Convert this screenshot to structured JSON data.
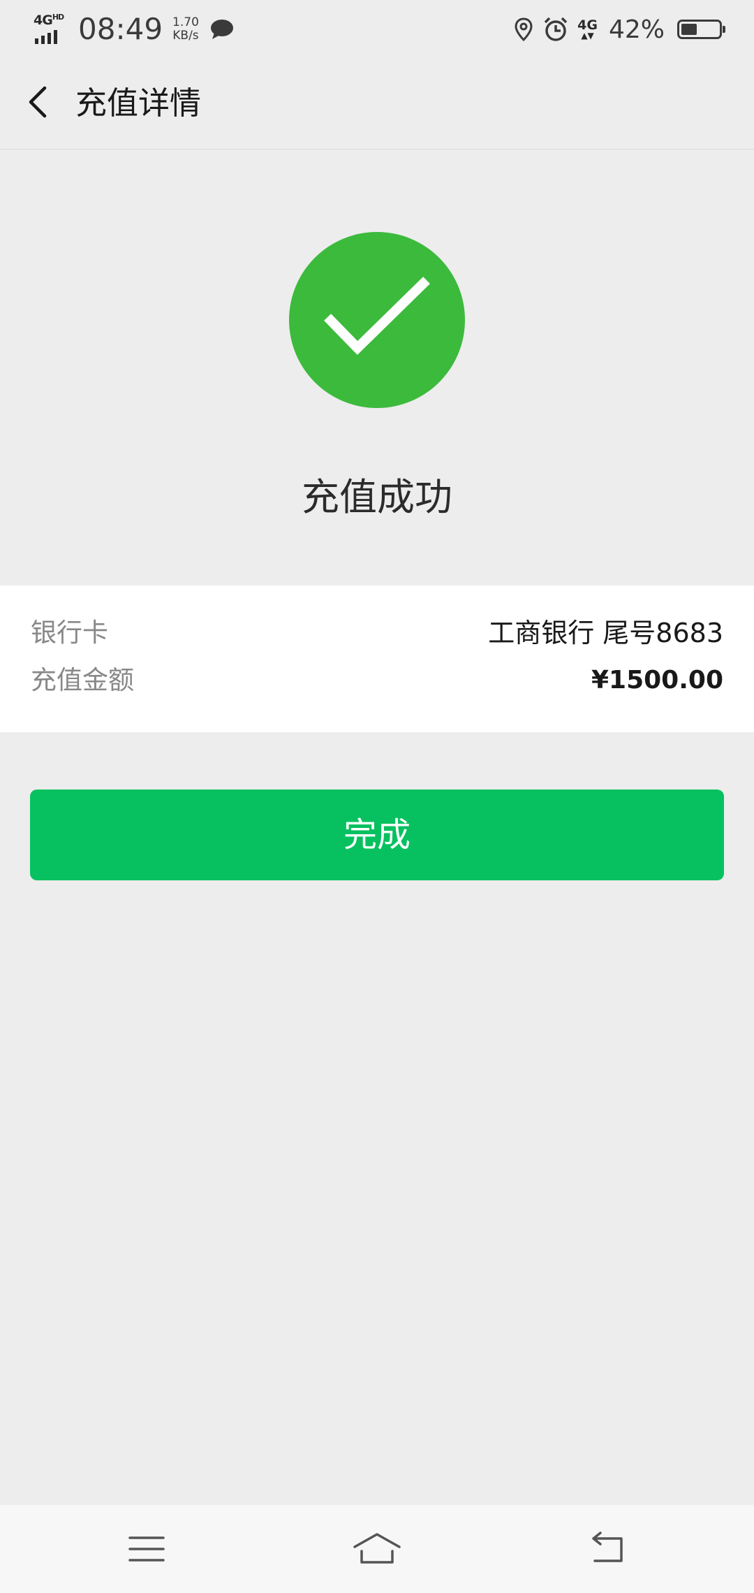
{
  "status_bar": {
    "network": "4G",
    "network_hd": "HD",
    "time": "08:49",
    "speed_value": "1.70",
    "speed_unit": "KB/s",
    "net_4g": "4G",
    "battery_percent": "42%",
    "battery_level": 0.42,
    "icons": [
      "signal-icon",
      "chat-bubble-icon",
      "location-icon",
      "alarm-icon",
      "data-transfer-icon",
      "battery-icon"
    ]
  },
  "header": {
    "title": "充值详情",
    "back_icon": "chevron-left-icon"
  },
  "result": {
    "icon": "check-circle-icon",
    "title": "充值成功",
    "accent_color": "#3cba3c"
  },
  "details": {
    "rows": [
      {
        "label": "银行卡",
        "value": "工商银行 尾号8683"
      },
      {
        "label": "充值金额",
        "value": "¥1500.00"
      }
    ]
  },
  "actions": {
    "done_label": "完成",
    "button_color": "#07c160"
  },
  "nav_bar": {
    "icons": [
      "menu-icon",
      "home-icon",
      "back-icon"
    ]
  }
}
